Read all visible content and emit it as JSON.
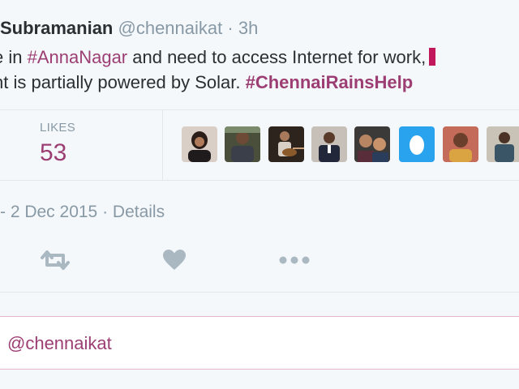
{
  "tweet": {
    "author_name": "Subramanian",
    "handle": "@chennaikat",
    "separator": "·",
    "time": "3h",
    "line1": {
      "pre": "e in ",
      "tag": "#AnnaNagar",
      "post": " and need to access Internet for work,"
    },
    "line2": {
      "pre": "nt is partially powered by Solar. ",
      "tag": "#ChennaiRainsHelp"
    }
  },
  "stats": {
    "likes_label": "LIKES",
    "likes_count": "53"
  },
  "liker_avatars": [
    "avatar-woman-dark-hair",
    "avatar-man-outdoors",
    "avatar-guitar-player",
    "avatar-man-suit",
    "avatar-couple",
    "avatar-default-egg",
    "avatar-child",
    "avatar-person-partial"
  ],
  "timestamp": "- 2 Dec 2015 · Details",
  "actions": {
    "retweet_icon": "retweet-icon",
    "like_icon": "heart-icon",
    "more_icon": "more-icon"
  },
  "reply": {
    "text": "@chennaikat"
  },
  "colors": {
    "hashtag": "#9c3e73",
    "muted": "#8899a6",
    "icon": "#aab8c2",
    "reply_border": "#e8b6cc",
    "default_avatar": "#2aa3ef"
  }
}
